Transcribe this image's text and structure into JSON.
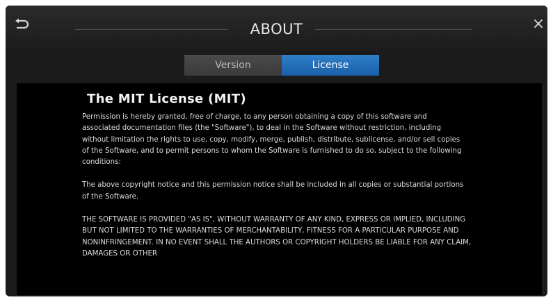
{
  "header": {
    "title": "ABOUT",
    "back_icon": "back-arrow-icon",
    "close_icon": "close-icon",
    "close_glyph": "×"
  },
  "tabs": [
    {
      "label": "Version",
      "active": false
    },
    {
      "label": "License",
      "active": true
    }
  ],
  "license": {
    "title": "The MIT License (MIT)",
    "paragraphs": [
      "Permission is hereby granted, free of charge, to any person obtaining a copy of this software and associated documentation files (the \"Software\"), to deal in the Software without restriction, including without limitation the rights to use, copy, modify, merge, publish, distribute, sublicense, and/or sell copies of the Software, and to permit persons to whom the Software is furnished to do so, subject to the following conditions:",
      "The above copyright notice and this permission notice shall be included in all copies or substantial portions of the Software.",
      "THE SOFTWARE IS PROVIDED \"AS IS\", WITHOUT WARRANTY OF ANY KIND, EXPRESS OR IMPLIED, INCLUDING BUT NOT LIMITED TO THE WARRANTIES OF MERCHANTABILITY, FITNESS FOR A PARTICULAR PURPOSE AND NONINFRINGEMENT. IN NO EVENT SHALL THE AUTHORS OR COPYRIGHT HOLDERS BE LIABLE FOR ANY CLAIM, DAMAGES OR OTHER"
    ]
  },
  "colors": {
    "accent": "#1f6db8",
    "background": "#000000",
    "frame": "#1b1b1b"
  }
}
